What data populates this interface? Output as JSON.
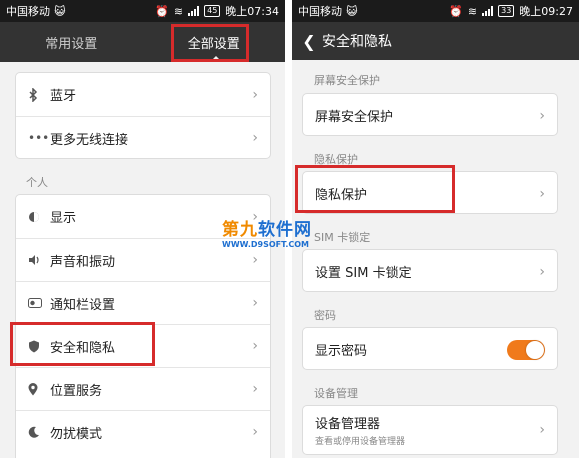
{
  "left": {
    "status": {
      "carrier": "中国移动",
      "emoji": "😺",
      "battery": "45",
      "time": "晚上07:34"
    },
    "tabs": [
      {
        "label": "常用设置"
      },
      {
        "label": "全部设置"
      }
    ],
    "group1": [
      {
        "icon": "bluetooth-icon",
        "label": "蓝牙"
      },
      {
        "icon": "more-icon",
        "label": "更多无线连接"
      }
    ],
    "section_personal": "个人",
    "group2": [
      {
        "icon": "display-icon",
        "label": "显示"
      },
      {
        "icon": "sound-icon",
        "label": "声音和振动"
      },
      {
        "icon": "notification-icon",
        "label": "通知栏设置"
      },
      {
        "icon": "shield-icon",
        "label": "安全和隐私"
      },
      {
        "icon": "location-icon",
        "label": "位置服务"
      },
      {
        "icon": "moon-icon",
        "label": "勿扰模式"
      }
    ]
  },
  "right": {
    "status": {
      "carrier": "中国移动",
      "emoji": "😺",
      "battery": "33",
      "time": "晚上09:27"
    },
    "title": "安全和隐私",
    "sections": [
      {
        "header": "屏幕安全保护",
        "item": "屏幕安全保护"
      },
      {
        "header": "隐私保护",
        "item": "隐私保护"
      },
      {
        "header": "SIM 卡锁定",
        "item": "设置 SIM 卡锁定"
      },
      {
        "header": "密码",
        "item": "显示密码"
      },
      {
        "header": "设备管理",
        "item": "设备管理器",
        "sub": "查看或停用设备管理器"
      }
    ]
  },
  "watermark": {
    "brand_a": "第九",
    "brand_b": "软件网",
    "url": "WWW.D9SOFT.COM"
  },
  "colors": {
    "highlight": "#d62b2b",
    "toggle_on": "#f07a1b",
    "bar": "#333333"
  }
}
